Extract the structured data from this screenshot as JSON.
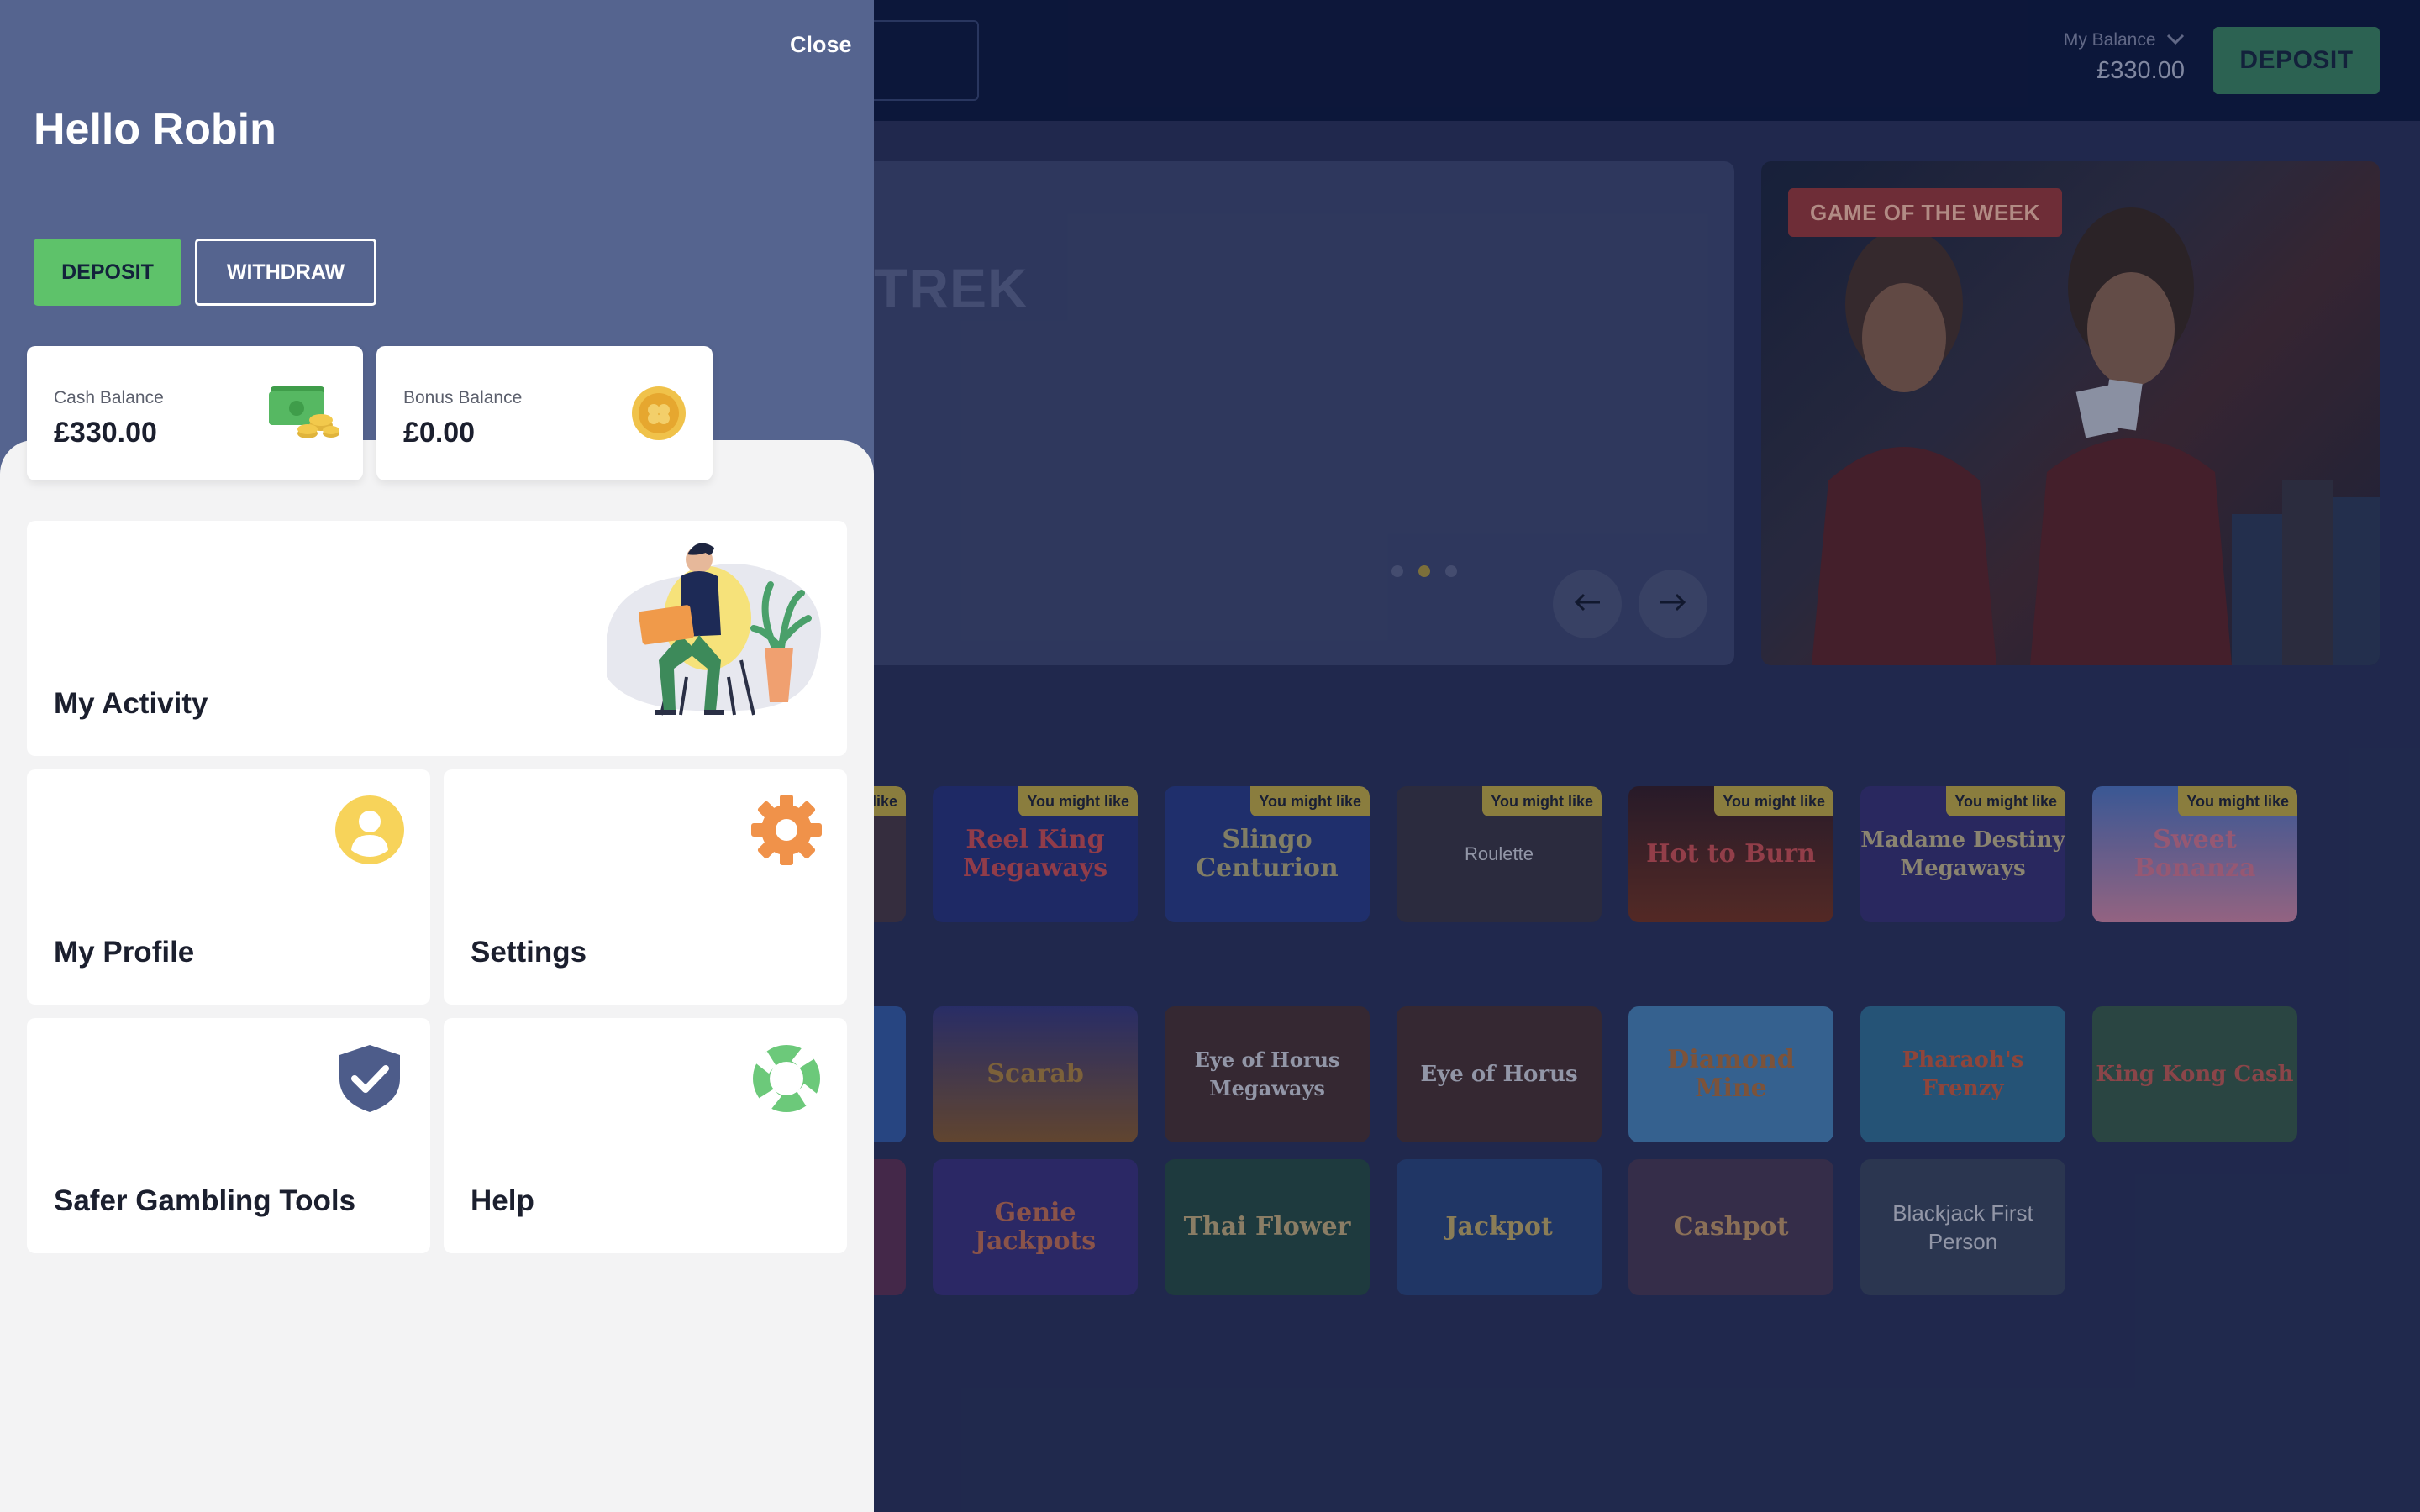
{
  "header": {
    "balance_label": "My Balance",
    "balance_amount": "£330.00",
    "deposit_label": "DEPOSIT"
  },
  "hero": {
    "title_fragment": "TREK",
    "slide_count": 3,
    "active_slide": 2
  },
  "game_of_the_week": {
    "badge": "GAME OF THE WEEK"
  },
  "recommended": {
    "badge": "You might like",
    "games": [
      "Reel King Megaways",
      "Slingo Centurion",
      "Roulette",
      "Hot to Burn",
      "Madame Destiny Megaways",
      "Sweet Bonanza"
    ]
  },
  "games_row_2": [
    "Scarab",
    "Eye of Horus Megaways",
    "Eye of Horus",
    "Diamond Mine",
    "Pharaoh's Frenzy",
    "King Kong Cash"
  ],
  "games_row_3": [
    "Genie Jackpots",
    "Thai Flower",
    "Jackpot",
    "Cashpot",
    "Blackjack First Person"
  ],
  "drawer": {
    "close_label": "Close",
    "greeting": "Hello Robin",
    "deposit_label": "DEPOSIT",
    "withdraw_label": "WITHDRAW",
    "cash_balance_label": "Cash Balance",
    "cash_balance_amount": "£330.00",
    "bonus_balance_label": "Bonus Balance",
    "bonus_balance_amount": "£0.00",
    "menu": {
      "activity": "My Activity",
      "profile": "My Profile",
      "settings": "Settings",
      "safer_gambling": "Safer Gambling Tools",
      "help": "Help"
    }
  },
  "colors": {
    "drawer_header": "#55648f",
    "deposit_green": "#5ec26a",
    "page_background": "#212a4f",
    "topbar": "#0b1639"
  }
}
